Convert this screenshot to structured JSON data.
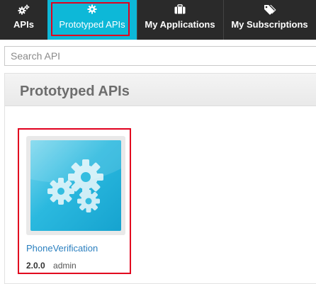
{
  "nav": {
    "tabs": [
      {
        "label": "APIs",
        "icon": "cogs-icon"
      },
      {
        "label": "Prototyped APIs",
        "icon": "gear-icon"
      },
      {
        "label": "My Applications",
        "icon": "briefcase-icon"
      },
      {
        "label": "My Subscriptions",
        "icon": "tags-icon"
      }
    ],
    "active_color": "#0db8d8",
    "bar_color": "#2a2a2a"
  },
  "search": {
    "placeholder": "Search API"
  },
  "panel": {
    "title": "Prototyped APIs"
  },
  "apis": [
    {
      "name": "PhoneVerification",
      "version": "2.0.0",
      "owner": "admin",
      "thumbnail_icon": "gears-icon"
    }
  ],
  "highlight_color": "#e1001e"
}
